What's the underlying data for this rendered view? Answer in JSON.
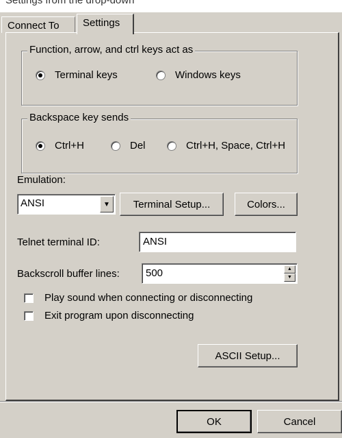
{
  "top_strip_text": "Settings from the drop-down",
  "tabs": [
    {
      "label": "Connect To",
      "active": false
    },
    {
      "label": "Settings",
      "active": true
    }
  ],
  "function_keys": {
    "legend": "Function, arrow, and ctrl keys act as",
    "options": [
      {
        "label": "Terminal keys",
        "selected": true
      },
      {
        "label": "Windows keys",
        "selected": false
      }
    ]
  },
  "backspace": {
    "legend": "Backspace key sends",
    "options": [
      {
        "label": "Ctrl+H",
        "selected": true
      },
      {
        "label": "Del",
        "selected": false
      },
      {
        "label": "Ctrl+H, Space, Ctrl+H",
        "selected": false
      }
    ]
  },
  "emulation": {
    "label": "Emulation:",
    "value": "ANSI",
    "terminal_setup_button": "Terminal Setup...",
    "colors_button": "Colors..."
  },
  "telnet": {
    "label": "Telnet terminal ID:",
    "value": "ANSI"
  },
  "backscroll": {
    "label": "Backscroll buffer lines:",
    "value": "500"
  },
  "options": [
    {
      "label": "Play sound when connecting or disconnecting",
      "checked": false
    },
    {
      "label": "Exit program upon disconnecting",
      "checked": false
    }
  ],
  "ascii_setup_button": "ASCII Setup...",
  "footer": {
    "ok": "OK",
    "cancel": "Cancel"
  },
  "icons": {
    "dropdown": "chevron-down-icon",
    "spin_up": "spin-up-icon",
    "spin_down": "spin-down-icon"
  }
}
